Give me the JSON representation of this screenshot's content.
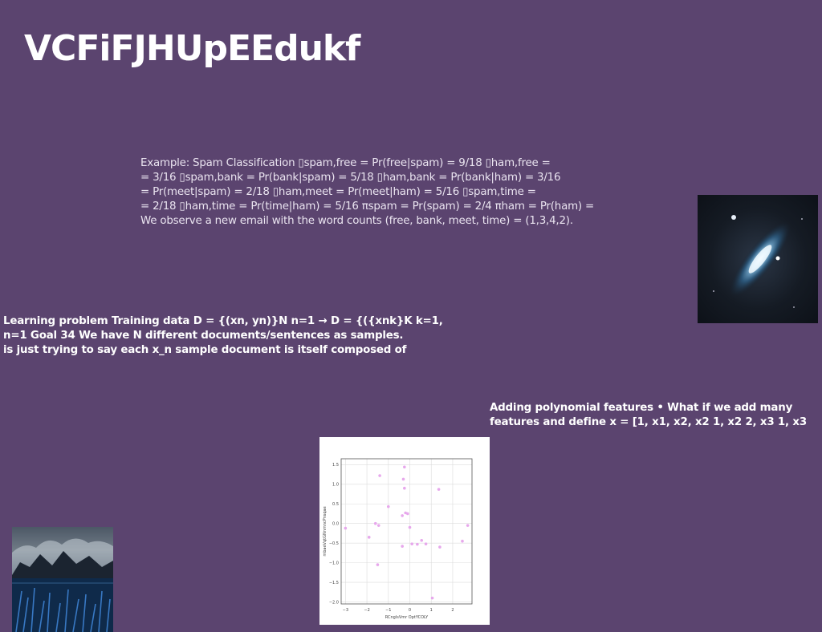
{
  "slide": {
    "title": "VCFiFJHUpEEdukf",
    "background_color": "#5b446f"
  },
  "example_text": {
    "lines": [
      "Example: Spam Classification ▯spam,free = Pr(free|spam) = 9/18 ▯ham,free =",
      "= 3/16 ▯spam,bank = Pr(bank|spam) = 5/18 ▯ham,bank = Pr(bank|ham) = 3/16",
      "= Pr(meet|spam) = 2/18 ▯ham,meet = Pr(meet|ham) = 5/16 ▯spam,time =",
      "= 2/18 ▯ham,time = Pr(time|ham) = 5/16 πspam = Pr(spam) = 2/4 πham = Pr(ham) =",
      "We observe a new email with the word counts (free, bank, meet, time) = (1,3,4,2)."
    ]
  },
  "learning_text": {
    "lines": [
      "Learning problem Training data D = {(xn, yn)}N n=1 → D = {({xnk}K k=1,",
      "n=1 Goal 34 We have N different documents/sentences as samples.",
      "is just trying to say each x_n sample document is itself composed of"
    ]
  },
  "poly_text": {
    "lines": [
      "Adding polynomial features • What if we add many",
      "features and define x = [1, x1, x2, x2 1, x2 2, x3 1, x3"
    ]
  },
  "images": {
    "galaxy": "galaxy-photo",
    "mountain": "mountain-lake-photo"
  },
  "chart_data": {
    "type": "scatter",
    "title": "",
    "xlabel": "RCnglsVmr OptYCOLY",
    "ylabel": "mbaeVqtGNnmncPnsqae",
    "xlim": [
      -3.2,
      2.9
    ],
    "ylim": [
      -2.05,
      1.65
    ],
    "x_ticks": [
      -3,
      -2,
      -1,
      0,
      1,
      2
    ],
    "y_ticks": [
      -2.0,
      -1.5,
      -1.0,
      -0.5,
      0.0,
      0.5,
      1.0,
      1.5
    ],
    "x_tick_labels": [
      "−3",
      "−2",
      "−1",
      "0",
      "1",
      "2"
    ],
    "y_tick_labels": [
      "−2.0",
      "−1.5",
      "−1.0",
      "−0.5",
      "0.0",
      "0.5",
      "1.0",
      "1.5"
    ],
    "grid": true,
    "point_color": "#e7a8ec",
    "series": [
      {
        "x": [
          -3.0,
          -1.5,
          -1.4,
          -1.0,
          -1.9,
          -1.6,
          -1.45,
          -0.35,
          -0.25,
          -0.3,
          -0.2,
          -0.1,
          0.0,
          0.1,
          0.35,
          0.55,
          0.75,
          1.05,
          1.35,
          1.4,
          2.45,
          2.7,
          -0.35,
          -0.25
        ],
        "y": [
          -0.12,
          -1.05,
          1.22,
          0.43,
          -0.35,
          0.0,
          -0.05,
          -0.58,
          1.44,
          1.13,
          0.27,
          0.25,
          -0.1,
          -0.52,
          -0.53,
          -0.43,
          -0.52,
          -1.9,
          0.87,
          -0.6,
          -0.45,
          -0.05,
          0.2,
          0.9
        ]
      }
    ]
  }
}
